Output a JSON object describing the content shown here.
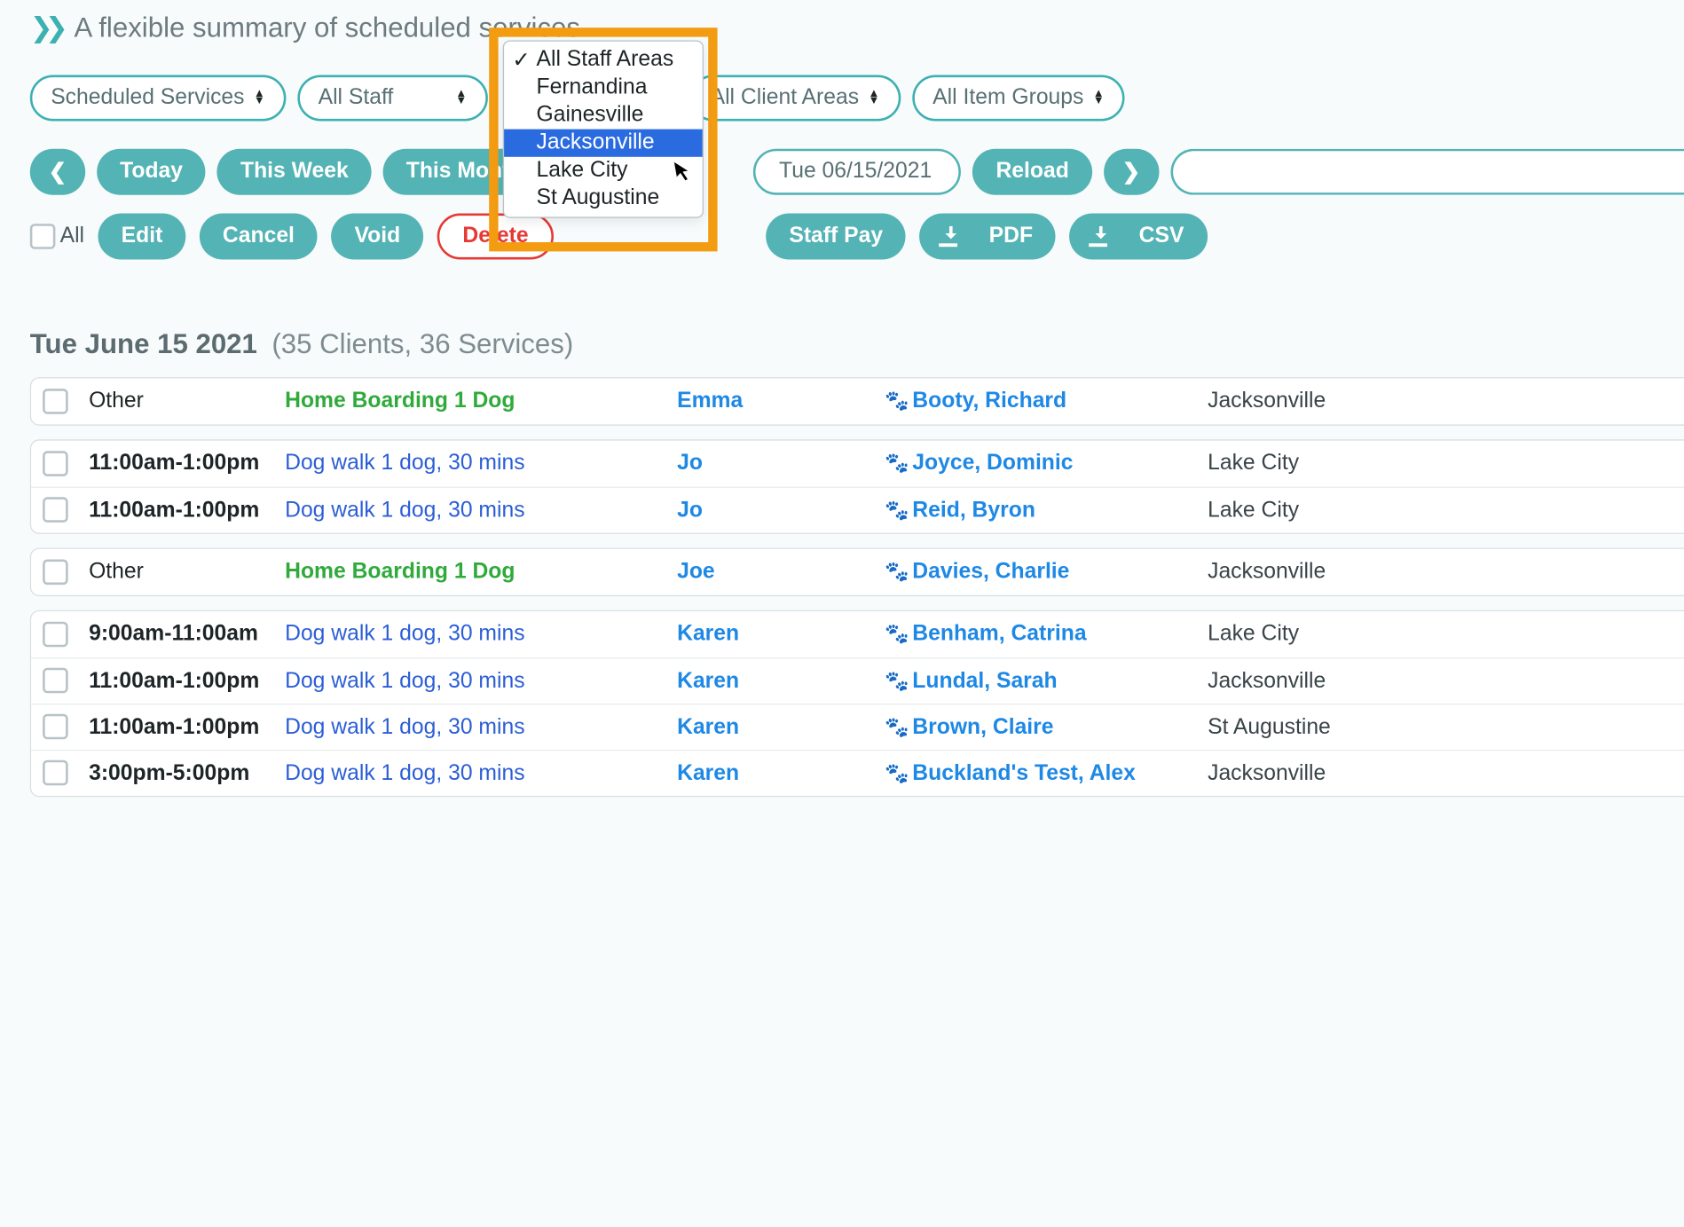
{
  "header": {
    "title": "A flexible summary of scheduled services."
  },
  "filters": {
    "scheduled": "Scheduled Services",
    "staff": "All Staff",
    "client_areas": "All Client Areas",
    "item_groups": "All Item Groups"
  },
  "staff_area_dropdown": {
    "selected": "All Staff Areas",
    "highlighted": "Jacksonville",
    "options": [
      "All Staff Areas",
      "Fernandina",
      "Gainesville",
      "Jacksonville",
      "Lake City",
      "St Augustine"
    ]
  },
  "dateNav": {
    "today": "Today",
    "thisWeek": "This Week",
    "thisMonth": "This Month",
    "from": "Tue 06/15/2021",
    "reload": "Reload"
  },
  "actions": {
    "allLabel": "All",
    "edit": "Edit",
    "cancel": "Cancel",
    "void": "Void",
    "delete": "Delete",
    "staffPay": "Staff Pay",
    "pdf": "PDF",
    "csv": "CSV"
  },
  "dateHeading": {
    "date": "Tue June 15 2021",
    "summary": "(35 Clients, 36 Services)"
  },
  "groups": [
    {
      "rows": [
        {
          "time": "Other",
          "timeClass": "other",
          "svc": "Home Boarding 1 Dog",
          "svcClass": "svc-green",
          "staff": "Emma",
          "client": "Booty, Richard",
          "area": "Jacksonville"
        }
      ]
    },
    {
      "rows": [
        {
          "time": "11:00am-1:00pm",
          "timeClass": "",
          "svc": "Dog walk 1 dog, 30 mins",
          "svcClass": "svc-blue",
          "staff": "Jo",
          "client": "Joyce, Dominic",
          "area": "Lake City"
        },
        {
          "time": "11:00am-1:00pm",
          "timeClass": "",
          "svc": "Dog walk 1 dog, 30 mins",
          "svcClass": "svc-blue",
          "staff": "Jo",
          "client": "Reid, Byron",
          "area": "Lake City"
        }
      ]
    },
    {
      "rows": [
        {
          "time": "Other",
          "timeClass": "other",
          "svc": "Home Boarding 1 Dog",
          "svcClass": "svc-green",
          "staff": "Joe",
          "client": "Davies, Charlie",
          "area": "Jacksonville"
        }
      ]
    },
    {
      "rows": [
        {
          "time": "9:00am-11:00am",
          "timeClass": "",
          "svc": "Dog walk 1 dog, 30 mins",
          "svcClass": "svc-blue",
          "staff": "Karen",
          "client": "Benham, Catrina",
          "area": "Lake City"
        },
        {
          "time": "11:00am-1:00pm",
          "timeClass": "",
          "svc": "Dog walk 1 dog, 30 mins",
          "svcClass": "svc-blue",
          "staff": "Karen",
          "client": "Lundal, Sarah",
          "area": "Jacksonville"
        },
        {
          "time": "11:00am-1:00pm",
          "timeClass": "",
          "svc": "Dog walk 1 dog, 30 mins",
          "svcClass": "svc-blue",
          "staff": "Karen",
          "client": "Brown, Claire",
          "area": "St Augustine"
        },
        {
          "time": "3:00pm-5:00pm",
          "timeClass": "",
          "svc": "Dog walk 1 dog, 30 mins",
          "svcClass": "svc-blue",
          "staff": "Karen",
          "client": "Buckland's Test, Alex",
          "area": "Jacksonville"
        }
      ]
    }
  ]
}
